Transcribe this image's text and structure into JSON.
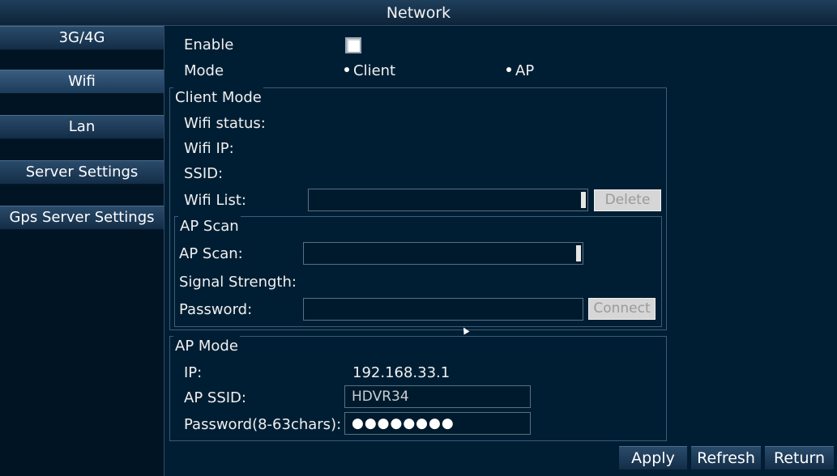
{
  "window": {
    "title": "Network"
  },
  "sidebar": {
    "items": [
      {
        "label": "3G/4G"
      },
      {
        "label": "Wifi"
      },
      {
        "label": "Lan"
      },
      {
        "label": "Server Settings"
      },
      {
        "label": "Gps Server Settings"
      }
    ]
  },
  "main": {
    "enable_label": "Enable",
    "enable_checked": true,
    "mode_label": "Mode",
    "mode_options": [
      {
        "label": "Client"
      },
      {
        "label": "AP"
      }
    ],
    "client_mode": {
      "title": "Client Mode",
      "wifi_status_label": "Wifi status:",
      "wifi_ip_label": "Wifi IP:",
      "ssid_label": "SSID:",
      "wifi_list_label": "Wifi List:",
      "wifi_list_value": "",
      "delete_label": "Delete"
    },
    "ap_scan": {
      "title": "AP Scan",
      "scan_label": "AP Scan:",
      "scan_value": "",
      "signal_label": "Signal Strength:",
      "password_label": "Password:",
      "password_value": "",
      "connect_label": "Connect"
    },
    "ap_mode": {
      "title": "AP Mode",
      "ip_label": "IP:",
      "ip_value": "192.168.33.1",
      "ssid_label": "AP SSID:",
      "ssid_value": "HDVR34",
      "password_label": "Password(8-63chars):",
      "password_value": "●●●●●●●●"
    }
  },
  "footer": {
    "apply_label": "Apply",
    "refresh_label": "Refresh",
    "return_label": "Return"
  }
}
